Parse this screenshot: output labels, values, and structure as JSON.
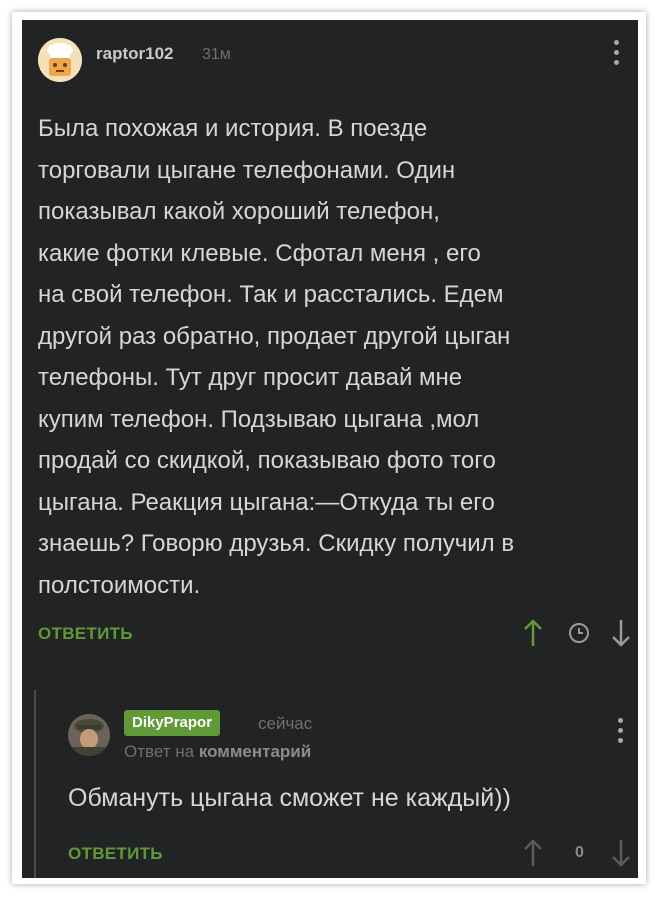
{
  "comment": {
    "username": "raptor102",
    "time": "31м",
    "body": "Была похожая и история. В поезде\nторговали цыгане телефонами. Один\nпоказывал какой хороший телефон,\nкакие фотки клевые. Сфотал меня , его\nна свой телефон. Так и расстались. Едем\nдругой раз обратно, продает другой цыган\nтелефоны. Тут друг просит давай мне\nкупим телефон. Подзываю цыгана ,мол\nпродай со скидкой, показываю фото того\nцыгана. Реакция цыгана:—Откуда ты его\nзнаешь? Говорю друзья. Скидку получил в\nполстоимости.",
    "reply_label": "ОТВЕТИТЬ",
    "icons": [
      "upvote-arrow-icon",
      "clock-icon",
      "downvote-arrow-icon"
    ]
  },
  "reply": {
    "username": "DikyPrapor",
    "time": "сейчас",
    "reply_to_prefix": "Ответ на",
    "reply_to_link": "комментарий",
    "body": "Обмануть цыгана сможет не каждый))",
    "reply_label": "ОТВЕТИТЬ",
    "rating": "0"
  },
  "colors": {
    "background": "#222325",
    "accent_green": "#5f9a37",
    "text": "#d6d6d6",
    "muted": "#6e6f71"
  }
}
